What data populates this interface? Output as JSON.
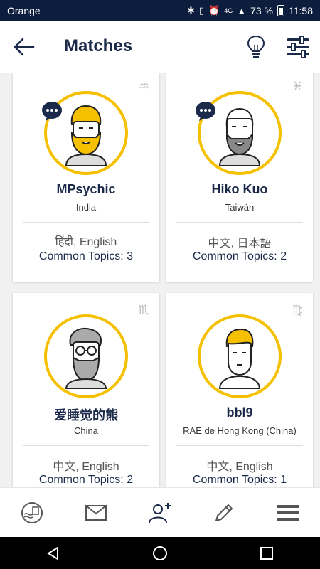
{
  "status": {
    "carrier": "Orange",
    "battery": "73 %",
    "time": "11:58",
    "network": "4G"
  },
  "header": {
    "title": "Matches"
  },
  "colors": {
    "accent": "#f5c000",
    "navy": "#1b2a4a",
    "statusbar": "#0c1d3d"
  },
  "cards": [
    {
      "name": "MPsychic",
      "country": "India",
      "languages": "हिंदी, English",
      "topics": "Common Topics: 3",
      "zodiac": "♒",
      "zodiac_icon": "aquarius-icon",
      "has_chat": true
    },
    {
      "name": "Hiko Kuo",
      "country": "Taiwán",
      "languages": "中文, 日本語",
      "topics": "Common Topics: 2",
      "zodiac": "♓",
      "zodiac_icon": "pisces-icon",
      "has_chat": true
    },
    {
      "name": "爱睡觉的熊",
      "country": "China",
      "languages": "中文, English",
      "topics": "Common Topics: 2",
      "zodiac": "♏",
      "zodiac_icon": "scorpio-icon",
      "has_chat": false
    },
    {
      "name": "bbl9",
      "country": "RAE de Hong Kong (China)",
      "languages": "中文, English",
      "topics": "Common Topics: 1",
      "zodiac": "♍",
      "zodiac_icon": "virgo-icon",
      "has_chat": false
    }
  ],
  "nav": {
    "items": [
      "postcard-icon",
      "mail-icon",
      "add-user-icon",
      "pencil-icon",
      "menu-icon"
    ]
  }
}
